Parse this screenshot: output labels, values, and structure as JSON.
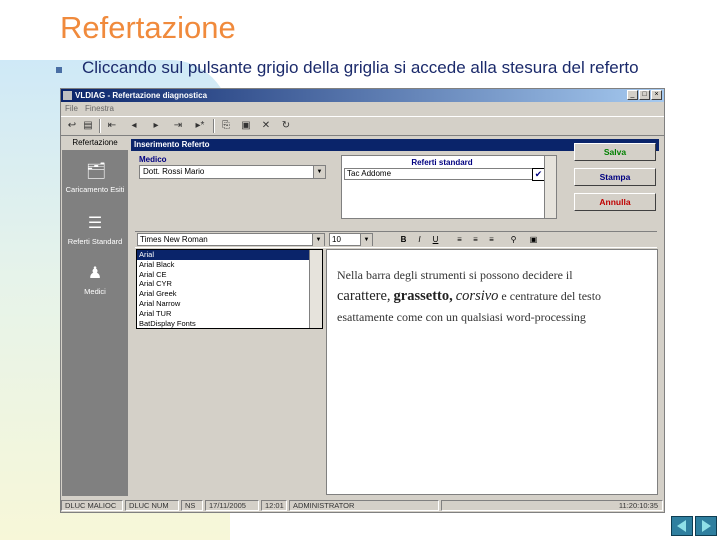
{
  "slide": {
    "title": "Refertazione",
    "bullet": "Cliccando sul pulsante grigio della griglia si accede alla stesura del referto"
  },
  "app": {
    "window_title": "VLDIAG - Refertazione diagnostica",
    "window_buttons": [
      "_",
      "□",
      "×"
    ],
    "menu": [
      "File",
      "Finestra"
    ],
    "sidebar": {
      "header": "Refertazione",
      "items": [
        {
          "label": "Caricamento Esiti",
          "icon": "folder-edit-icon"
        },
        {
          "label": "Referti Standard",
          "icon": "document-list-icon"
        },
        {
          "label": "Medici",
          "icon": "person-icon"
        }
      ]
    },
    "panel": {
      "title": "Inserimento Referto",
      "medico_label": "Medico",
      "medico_value": "Dott. Rossi Mario",
      "referti_header": "Referti standard",
      "referti_item": "Tac Addome",
      "referti_checked": true,
      "buttons": {
        "save": "Salva",
        "print": "Stampa",
        "cancel": "Annulla"
      },
      "save_color": "#008000",
      "print_color": "#000080",
      "cancel_color": "#c00000"
    },
    "format": {
      "font": "Times New Roman",
      "size": "10",
      "buttons": [
        "B",
        "I",
        "U"
      ]
    },
    "font_list": [
      "Arial",
      "Arial Black",
      "Arial CE",
      "Arial CYR",
      "Arial Greek",
      "Arial Narrow",
      "Arial TUR",
      "BatDisplay Fonts"
    ],
    "editor": {
      "line1": "Nella barra degli strumenti si possono decidere il",
      "carattere": "carattere,",
      "grassetto": "grassetto,",
      "corsivo": "corsivo",
      "line2_tail": "e centrature del testo",
      "line3": "esattamente come con un qualsiasi word-processing"
    },
    "statusbar": [
      "DLUC MALIOC",
      "DLUC NUM",
      "NS",
      "17/11/2005",
      "12:01",
      "ADMINISTRATOR",
      "11:20:10:35"
    ]
  }
}
